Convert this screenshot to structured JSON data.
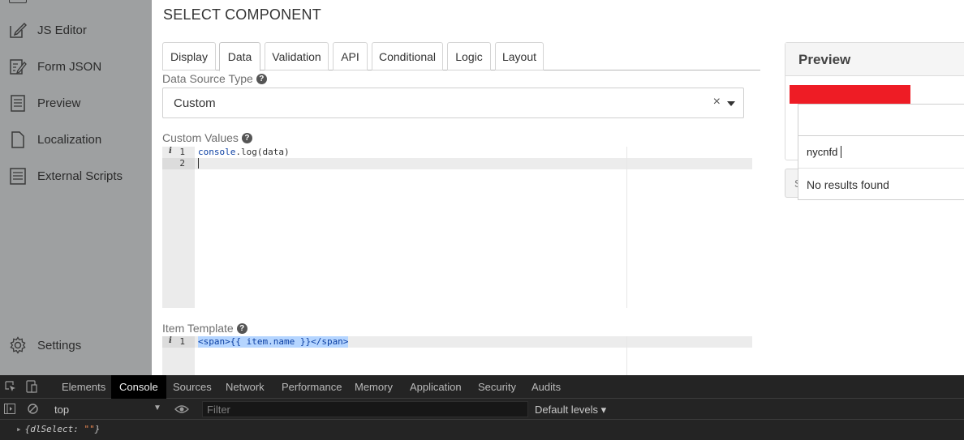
{
  "sidebar": {
    "items": [
      {
        "label": "JS Editor",
        "icon": "edit-icon"
      },
      {
        "label": "Form JSON",
        "icon": "json-edit-icon"
      },
      {
        "label": "Preview",
        "icon": "document-list-icon"
      },
      {
        "label": "Localization",
        "icon": "file-icon"
      },
      {
        "label": "External Scripts",
        "icon": "script-list-icon"
      }
    ],
    "settings": {
      "label": "Settings",
      "icon": "gear-icon"
    }
  },
  "main": {
    "title": "SELECT COMPONENT",
    "tabs": [
      "Display",
      "Data",
      "Validation",
      "API",
      "Conditional",
      "Logic",
      "Layout"
    ],
    "active_tab": "Data",
    "data_source": {
      "label": "Data Source Type",
      "value": "Custom",
      "clear_symbol": "×"
    },
    "custom_values": {
      "label": "Custom Values",
      "lines": [
        {
          "number": "1",
          "code_prefix": "console",
          "code_rest": ".log(data)"
        },
        {
          "number": "2",
          "code_prefix": "",
          "code_rest": ""
        }
      ]
    },
    "item_template": {
      "label": "Item Template",
      "lines": [
        {
          "number": "1",
          "code": "<span>{{ item.name }}</span>"
        }
      ]
    },
    "help_symbol": "?",
    "info_symbol": "i"
  },
  "preview": {
    "title": "Preview",
    "search_value": "nycnfd",
    "no_results": "No results found",
    "submit_partial": "S"
  },
  "devtools": {
    "tabs": [
      "Elements",
      "Console",
      "Sources",
      "Network",
      "Performance",
      "Memory",
      "Application",
      "Security",
      "Audits"
    ],
    "active_tab": "Console",
    "context": "top",
    "filter_placeholder": "Filter",
    "levels": "Default levels ▾",
    "console_output": {
      "prefix": "{dlSelect: ",
      "value": "\"\"",
      "suffix": "}"
    }
  }
}
